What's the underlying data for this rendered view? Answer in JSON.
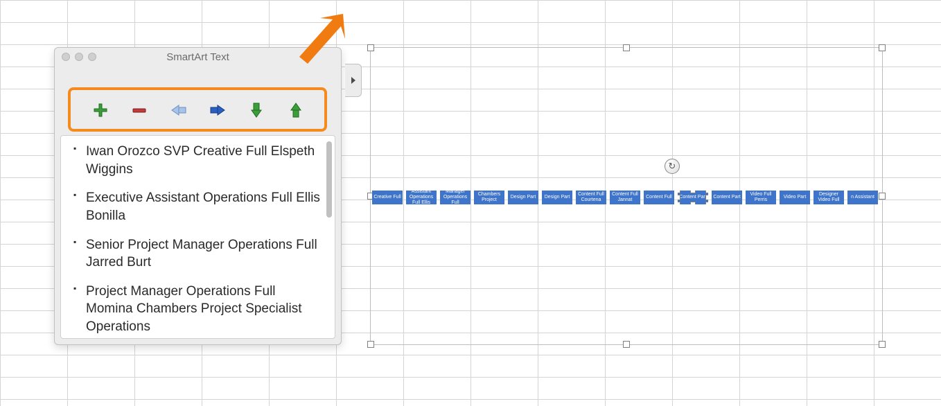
{
  "panel": {
    "title": "SmartArt Text"
  },
  "toolbar": {
    "add": "Add",
    "remove": "Remove",
    "demote": "Demote",
    "promote": "Promote",
    "move_down": "Move Down",
    "move_up": "Move Up"
  },
  "text_items": [
    "Iwan Orozco  SVP Creative Full Elspeth Wiggins",
    "Executive Assistant Operations Full Ellis Bonilla",
    "Senior Project Manager Operations Full Jarred Burt",
    "Project Manager Operations Full Momina Chambers Project Specialist  Operations"
  ],
  "nodes": [
    {
      "label": "Creative Full"
    },
    {
      "label": "Assistant Operations Full Ellis"
    },
    {
      "label": "Manager Operations Full"
    },
    {
      "label": "Chambers Project"
    },
    {
      "label": "Design Part"
    },
    {
      "label": "Design Part"
    },
    {
      "label": "Content Full Courtena"
    },
    {
      "label": "Content Full Jannat"
    },
    {
      "label": "Content Full"
    },
    {
      "label": "Content Part"
    },
    {
      "label": "Content Part"
    },
    {
      "label": "Video Full Perris"
    },
    {
      "label": "Video Part"
    },
    {
      "label": "Designer Video Full"
    },
    {
      "label": "n Assistant"
    }
  ],
  "selected_node_index": 9,
  "colors": {
    "highlight": "#f58b1f",
    "arrow": "#f07c11",
    "node": "#3e74c9"
  }
}
